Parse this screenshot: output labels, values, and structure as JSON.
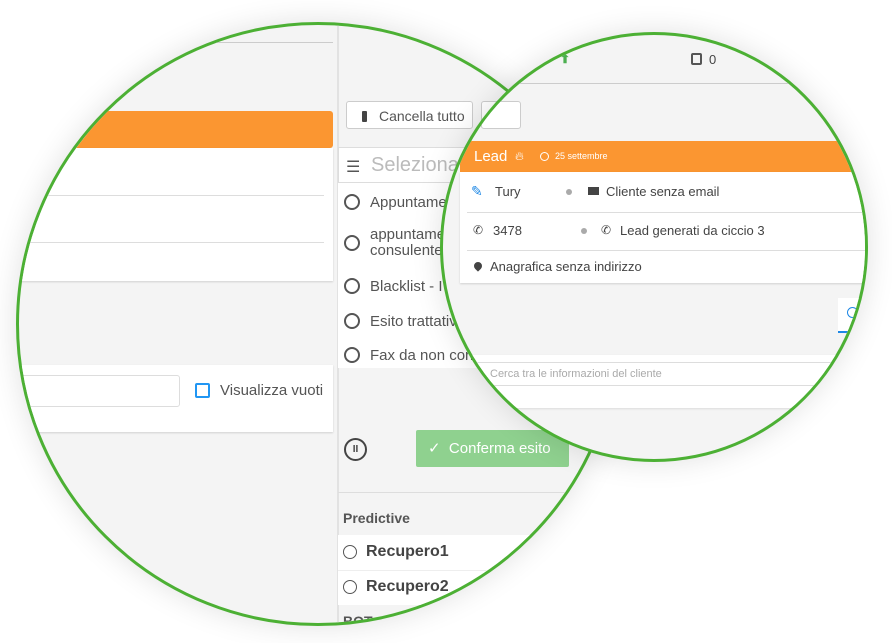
{
  "left_panel": {
    "visualizza_vuoti_label": "Visualizza vuoti"
  },
  "outcome_panel": {
    "cancella_tutto_label": "Cancella tutto",
    "select_placeholder": "Seleziona",
    "options": [
      "Appuntamento",
      "appuntamento consulente",
      "Blacklist - I",
      "Esito trattativa",
      "Fax da non con"
    ],
    "option_2_line2": "consulente",
    "confirm_label": "Conferma esito",
    "section_predictive": "Predictive",
    "predictive_items": [
      "Recupero1",
      "Recupero2"
    ],
    "section_next": "BOT"
  },
  "header": {
    "calendar_count": "0"
  },
  "lead_card": {
    "status": "Lead",
    "date": "25 settembre",
    "name": "Tury",
    "email": "Cliente senza email",
    "phone": "3478",
    "list": "Lead generati da ciccio 3",
    "address": "Anagrafica senza indirizzo",
    "search_placeholder": "Cerca tra le informazioni del cliente"
  },
  "colors": {
    "accent": "#fb9631",
    "ring": "#4cb034",
    "confirm": "#8fd18f",
    "link": "#1e88e5"
  }
}
